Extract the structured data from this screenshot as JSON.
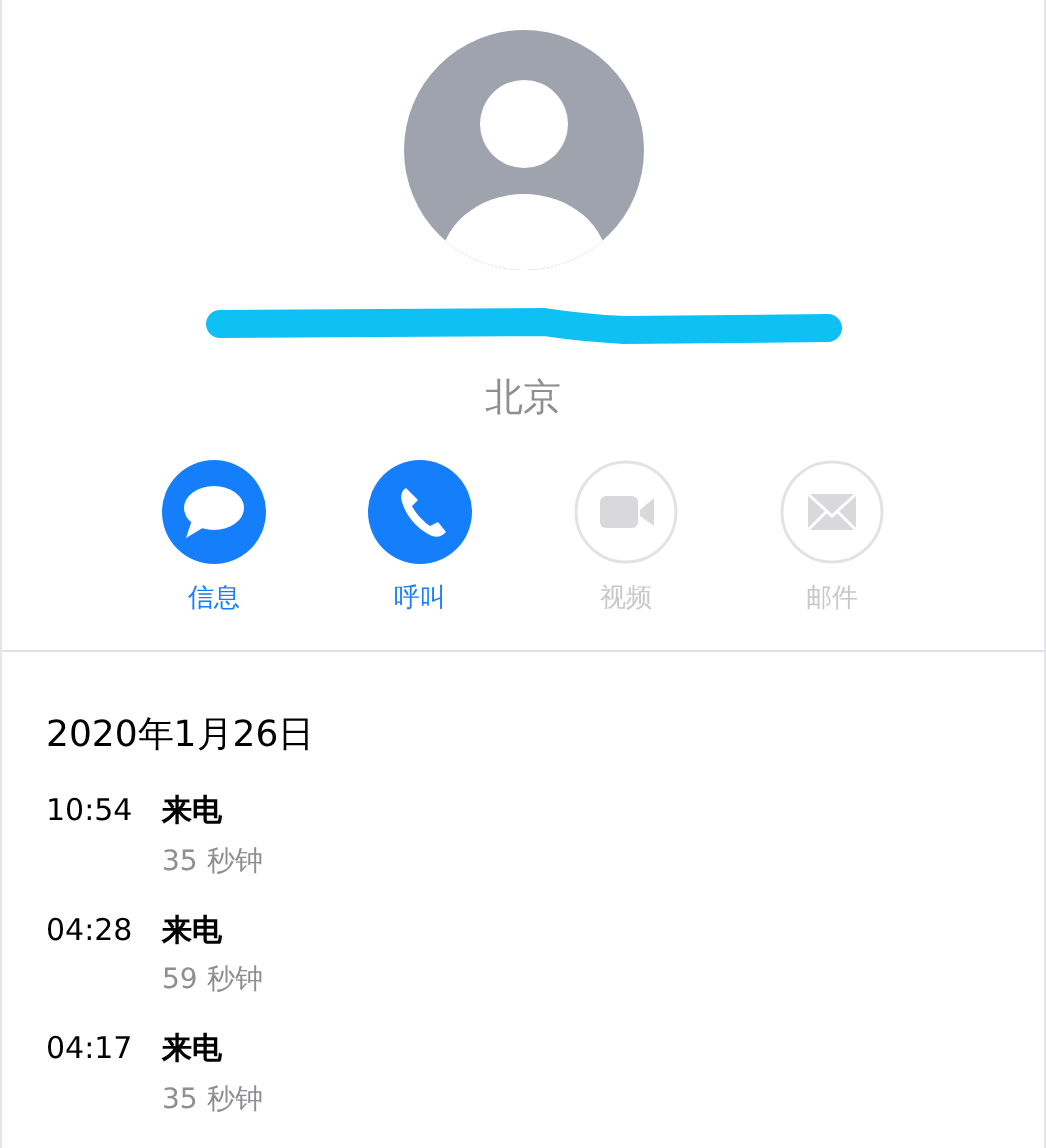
{
  "contact": {
    "location": "北京"
  },
  "actions": [
    {
      "kind": "message",
      "label": "信息",
      "disabled": false
    },
    {
      "kind": "call",
      "label": "呼叫",
      "disabled": false
    },
    {
      "kind": "video",
      "label": "视频",
      "disabled": true
    },
    {
      "kind": "mail",
      "label": "邮件",
      "disabled": true
    }
  ],
  "history": {
    "date": "2020年1月26日",
    "calls": [
      {
        "time": "10:54",
        "type": "来电",
        "duration": "35 秒钟"
      },
      {
        "time": "04:28",
        "type": "来电",
        "duration": "59 秒钟"
      },
      {
        "time": "04:17",
        "type": "来电",
        "duration": "35 秒钟"
      }
    ]
  }
}
